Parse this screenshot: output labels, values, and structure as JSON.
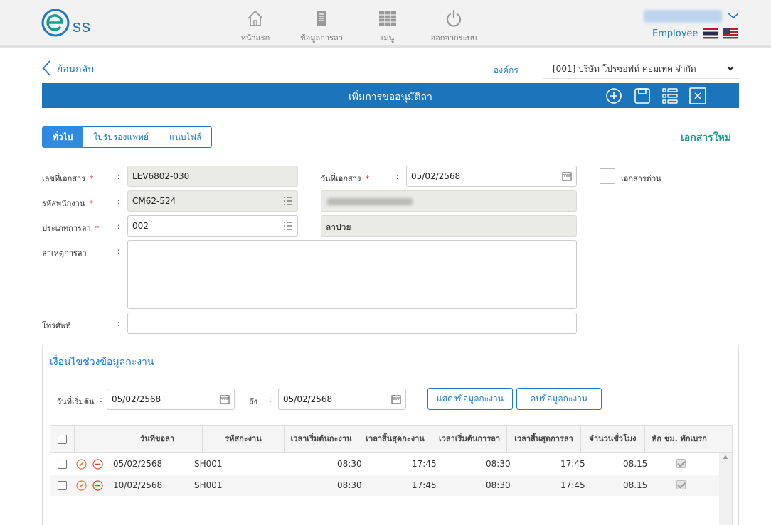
{
  "header": {
    "logo_text": "ss",
    "nav": [
      {
        "label": "หน้าแรก",
        "icon": "home-icon"
      },
      {
        "label": "ข้อมูลการลา",
        "icon": "document-icon"
      },
      {
        "label": "เมนู",
        "icon": "grid-menu-icon"
      },
      {
        "label": "ออกจากระบบ",
        "icon": "power-icon"
      }
    ],
    "role": "Employee"
  },
  "page": {
    "back_label": "ย้อนกลับ",
    "org_label": "องค์กร",
    "org_value": "[001] บริษัท โปรซอฟท์ คอมเทค จำกัด",
    "title": "เพิ่มการขออนุมัติลา",
    "new_doc_label": "เอกสารใหม่"
  },
  "tabs": [
    "ทั่วไป",
    "ใบรับรองแพทย์",
    "แนบไฟล์"
  ],
  "form": {
    "doc_no": {
      "label": "เลขที่เอกสาร",
      "value": "LEV6802-030"
    },
    "doc_date": {
      "label": "วันที่เอกสาร",
      "value": "05/02/2568"
    },
    "urgent_label": "เอกสารด่วน",
    "employee": {
      "label": "รหัสพนักงาน",
      "value": "CM62-524"
    },
    "leave_type": {
      "label": "ประเภทการลา",
      "value": "002",
      "name": "ลาป่วย"
    },
    "reason": {
      "label": "สาเหตุการลา",
      "value": ""
    },
    "phone": {
      "label": "โทรศัพท์",
      "value": ""
    }
  },
  "work_panel": {
    "title": "เงื่อนไขช่วงข้อมูลกะงาน",
    "start_label": "วันที่เริ่มต้น",
    "start_value": "05/02/2568",
    "to_label": "ถึง",
    "end_value": "05/02/2568",
    "show_button": "แสดงข้อมูลกะงาน",
    "delete_button": "ลบข้อมูลกะงาน"
  },
  "grid": {
    "columns": [
      "วันที่ขอลา",
      "รหัสกะงาน",
      "เวลาเริ่มต้นกะงาน",
      "เวลาสิ้นสุดกะงาน",
      "เวลาเริ่มต้นการลา",
      "เวลาสิ้นสุดการลา",
      "จำนวนชั่วโมง",
      "หัก ชม. พักเบรก"
    ],
    "rows": [
      {
        "date": "05/02/2568",
        "shift": "SH001",
        "shift_start": "08:30",
        "shift_end": "17:45",
        "leave_start": "08:30",
        "leave_end": "17:45",
        "hours": "08.15",
        "deduct_break": true
      },
      {
        "date": "10/02/2568",
        "shift": "SH001",
        "shift_start": "08:30",
        "shift_end": "17:45",
        "leave_start": "08:30",
        "leave_end": "17:45",
        "hours": "08.15",
        "deduct_break": true
      }
    ]
  },
  "colors": {
    "primary": "#1c74bb",
    "accent_text": "#1f7acb",
    "new_doc": "#1a9f8e",
    "required": "#d9342b"
  }
}
